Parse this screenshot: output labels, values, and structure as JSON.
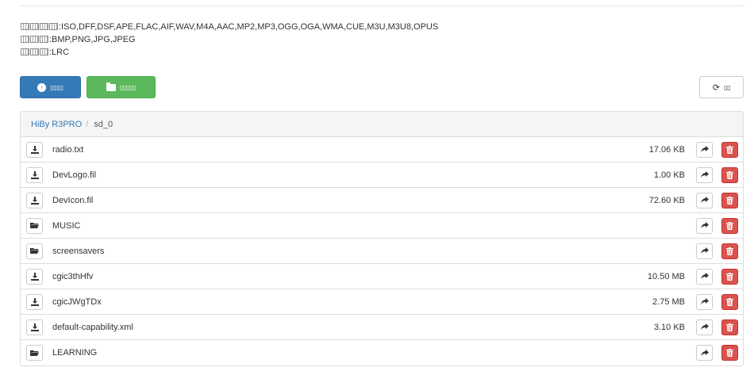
{
  "formats": [
    {
      "prefix_glyphs": 4,
      "text": ":ISO,DFF,DSF,APE,FLAC,AIF,WAV,M4A,AAC,MP2,MP3,OGG,OGA,WMA,CUE,M3U,M3U8,OPUS"
    },
    {
      "prefix_glyphs": 3,
      "text": ":BMP,PNG,JPG,JPEG"
    },
    {
      "prefix_glyphs": 3,
      "text": ":LRC"
    }
  ],
  "toolbar": {
    "upload_label": "▯▯▯▯",
    "newfolder_label": "▯▯▯▯▯",
    "refresh_label": "▯▯"
  },
  "breadcrumb": {
    "root": "HiBy R3PRO",
    "separator": "/",
    "current": "sd_0"
  },
  "files": [
    {
      "kind": "file",
      "name": "radio.txt",
      "size": "17.06 KB"
    },
    {
      "kind": "file",
      "name": "DevLogo.fil",
      "size": "1.00 KB"
    },
    {
      "kind": "file",
      "name": "DevIcon.fil",
      "size": "72.60 KB"
    },
    {
      "kind": "folder",
      "name": "MUSIC",
      "size": ""
    },
    {
      "kind": "folder",
      "name": "screensavers",
      "size": ""
    },
    {
      "kind": "file",
      "name": "cgic3thHfv",
      "size": "10.50 MB"
    },
    {
      "kind": "file",
      "name": "cgicJWgTDx",
      "size": "2.75 MB"
    },
    {
      "kind": "file",
      "name": "default-capability.xml",
      "size": "3.10 KB"
    },
    {
      "kind": "folder",
      "name": "LEARNING",
      "size": ""
    }
  ],
  "colors": {
    "primary": "#337ab7",
    "success": "#5cb85c",
    "danger": "#d9534f"
  }
}
